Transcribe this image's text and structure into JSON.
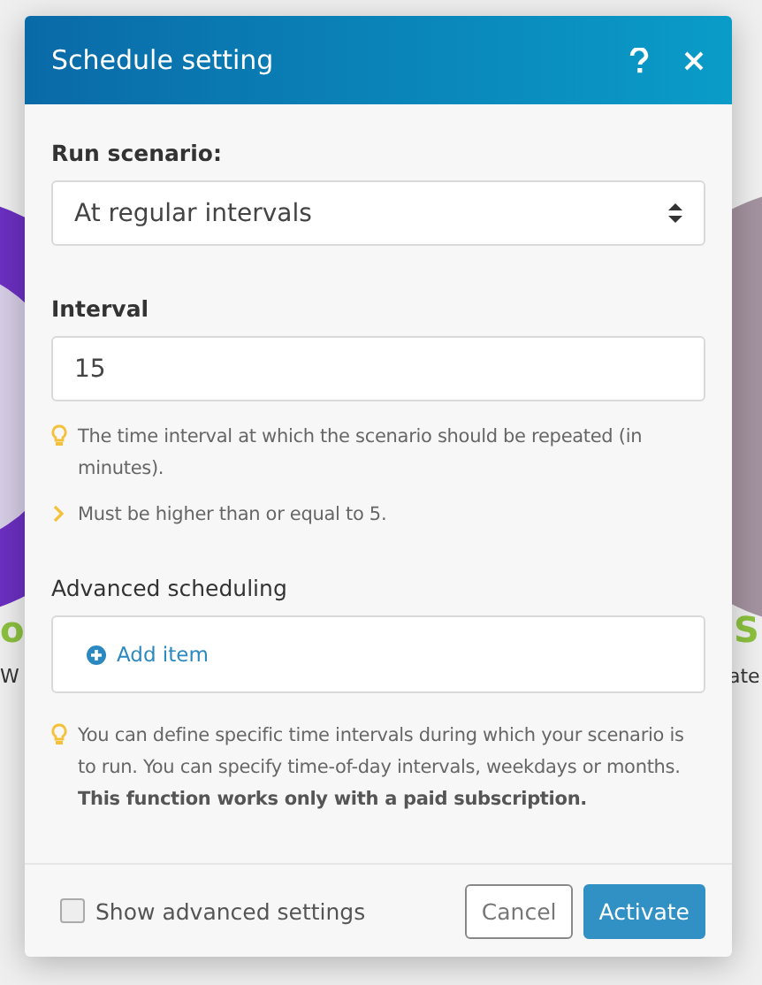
{
  "background": {
    "left": {
      "title": "o",
      "caption": "W"
    },
    "right": {
      "title": "S",
      "caption": "ate"
    }
  },
  "dialog": {
    "title": "Schedule setting",
    "run_scenario": {
      "label": "Run scenario:",
      "value": "At regular intervals"
    },
    "interval": {
      "label": "Interval",
      "value": "15",
      "hints": [
        {
          "kind": "tip",
          "text": "The time interval at which the scenario should be repeated (in minutes)."
        },
        {
          "kind": "rule",
          "text": "Must be higher than or equal to 5."
        }
      ]
    },
    "advanced_scheduling": {
      "label": "Advanced scheduling",
      "add_item": "Add item",
      "hints": [
        {
          "kind": "tip",
          "text": "You can define specific time intervals during which your scenario is to run. You can specify time-of-day intervals, weekdays or months. **This function works only with a paid subscription.**"
        }
      ]
    },
    "footer": {
      "checkbox": {
        "label": "Show advanced settings",
        "checked": false
      },
      "buttons": [
        {
          "label": "Cancel",
          "kind": "secondary"
        },
        {
          "label": "Activate",
          "kind": "primary"
        }
      ]
    }
  }
}
